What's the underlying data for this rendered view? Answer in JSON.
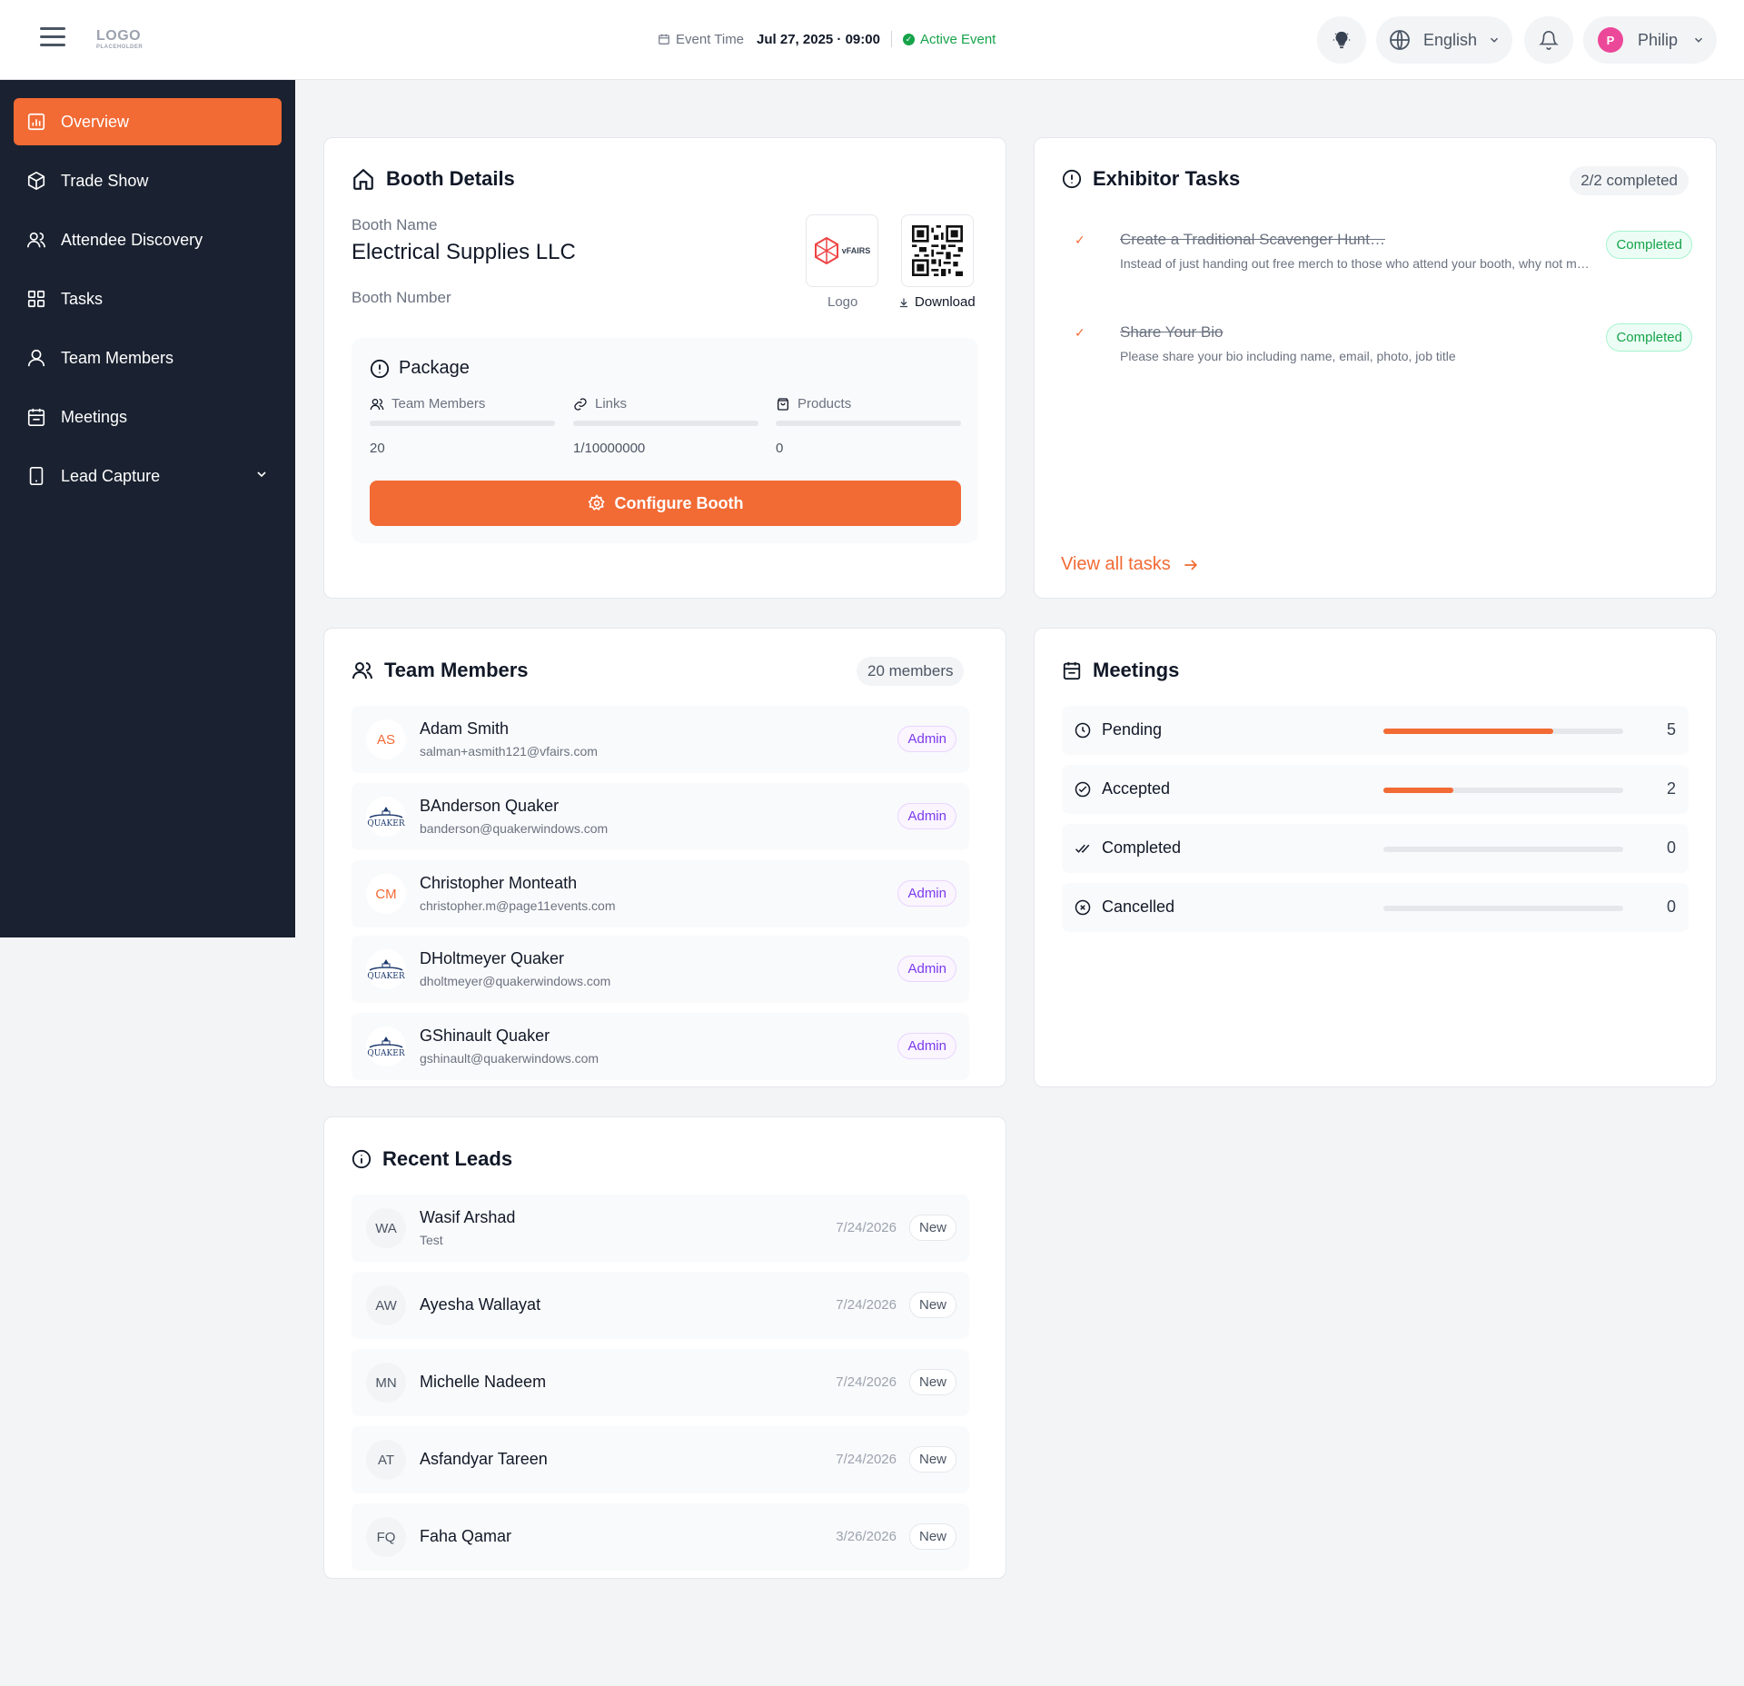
{
  "header": {
    "logo_main": "LOGO",
    "logo_sub": "PLACEHOLDER",
    "event_time_label": "Event Time",
    "event_time_value": "Jul 27, 2025 · 09:00",
    "event_status": "Active Event",
    "language": "English",
    "user_initial": "P",
    "user_name": "Philip"
  },
  "sidebar": {
    "items": [
      {
        "label": "Overview",
        "icon": "overview-icon"
      },
      {
        "label": "Trade Show",
        "icon": "box-icon"
      },
      {
        "label": "Attendee Discovery",
        "icon": "users-icon"
      },
      {
        "label": "Tasks",
        "icon": "grid-icon"
      },
      {
        "label": "Team Members",
        "icon": "user-icon"
      },
      {
        "label": "Meetings",
        "icon": "calendar-icon"
      },
      {
        "label": "Lead Capture",
        "icon": "phone-icon"
      }
    ]
  },
  "booth": {
    "title": "Booth Details",
    "name_label": "Booth Name",
    "name_value": "Electrical Supplies LLC",
    "number_label": "Booth Number",
    "logo_caption": "Logo",
    "logo_text": "vFAIRS",
    "download_caption": "Download",
    "package": {
      "title": "Package",
      "columns": [
        {
          "label": "Team Members",
          "value": "20"
        },
        {
          "label": "Links",
          "value": "1/10000000"
        },
        {
          "label": "Products",
          "value": "0"
        }
      ]
    },
    "configure_label": "Configure Booth"
  },
  "tasks": {
    "title": "Exhibitor Tasks",
    "count_badge": "2/2 completed",
    "items": [
      {
        "title": "Create a Traditional Scavenger Hunt…",
        "description": "Instead of just handing out free merch to those who attend your booth, why not m…",
        "status": "Completed"
      },
      {
        "title": "Share Your Bio",
        "description": "Please share your bio including name, email, photo, job title",
        "status": "Completed"
      }
    ],
    "view_all_label": "View all tasks"
  },
  "team": {
    "title": "Team Members",
    "count_badge": "20 members",
    "members": [
      {
        "initials": "AS",
        "name": "Adam Smith",
        "email": "salman+asmith121@vfairs.com",
        "role": "Admin",
        "avatar": "initials"
      },
      {
        "initials": "",
        "name": "BAnderson Quaker",
        "email": "banderson@quakerwindows.com",
        "role": "Admin",
        "avatar": "quaker-logo"
      },
      {
        "initials": "CM",
        "name": "Christopher Monteath",
        "email": "christopher.m@page11events.com",
        "role": "Admin",
        "avatar": "initials"
      },
      {
        "initials": "",
        "name": "DHoltmeyer Quaker",
        "email": "dholtmeyer@quakerwindows.com",
        "role": "Admin",
        "avatar": "quaker-logo"
      },
      {
        "initials": "",
        "name": "GShinault Quaker",
        "email": "gshinault@quakerwindows.com",
        "role": "Admin",
        "avatar": "quaker-logo"
      }
    ]
  },
  "meetings": {
    "title": "Meetings",
    "rows": [
      {
        "label": "Pending",
        "value": "5",
        "fraction": 0.71,
        "icon": "clock-icon"
      },
      {
        "label": "Accepted",
        "value": "2",
        "fraction": 0.29,
        "icon": "check-circle-icon"
      },
      {
        "label": "Completed",
        "value": "0",
        "fraction": 0,
        "icon": "double-check-icon"
      },
      {
        "label": "Cancelled",
        "value": "0",
        "fraction": 0,
        "icon": "x-circle-icon"
      }
    ]
  },
  "leads": {
    "title": "Recent Leads",
    "items": [
      {
        "initials": "WA",
        "name": "Wasif Arshad",
        "company": "Test",
        "date": "7/24/2026",
        "status": "New"
      },
      {
        "initials": "AW",
        "name": "Ayesha Wallayat",
        "company": "",
        "date": "7/24/2026",
        "status": "New"
      },
      {
        "initials": "MN",
        "name": "Michelle Nadeem",
        "company": "",
        "date": "7/24/2026",
        "status": "New"
      },
      {
        "initials": "AT",
        "name": "Asfandyar Tareen",
        "company": "",
        "date": "7/24/2026",
        "status": "New"
      },
      {
        "initials": "FQ",
        "name": "Faha Qamar",
        "company": "",
        "date": "3/26/2026",
        "status": "New"
      }
    ]
  },
  "colors": {
    "accent": "#f26a34",
    "sidebar_bg": "#1a2130",
    "success": "#16a34a",
    "admin": "#7c3aed",
    "avatar_pink": "#ec4899"
  }
}
